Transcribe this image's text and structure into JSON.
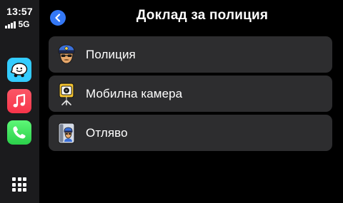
{
  "status": {
    "time": "13:57",
    "network": "5G"
  },
  "sidebar": {
    "apps": [
      {
        "name": "Waze",
        "icon": "waze-icon",
        "color": "#33ccff"
      },
      {
        "name": "Music",
        "icon": "music-note-icon",
        "color": "#fa3d4f"
      },
      {
        "name": "Phone",
        "icon": "phone-icon",
        "color": "#34d058"
      }
    ],
    "grid_icon": "app-grid-icon"
  },
  "header": {
    "title": "Доклад за полиция",
    "back_icon": "chevron-left-icon",
    "accent": "#3478f6"
  },
  "items": [
    {
      "label": "Полиция",
      "icon": "police-officer-icon"
    },
    {
      "label": "Мобилна камера",
      "icon": "mobile-camera-icon"
    },
    {
      "label": "Отляво",
      "icon": "police-left-side-icon"
    }
  ]
}
